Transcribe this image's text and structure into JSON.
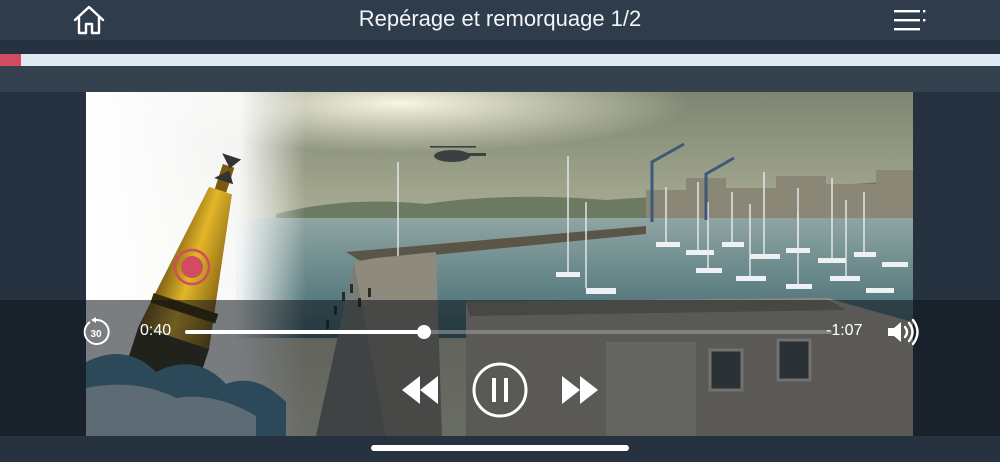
{
  "header": {
    "title": "Repérage et remorquage 1/2",
    "home_icon": "home-icon",
    "menu_icon": "menu-list-icon"
  },
  "lesson_progress": {
    "value": 0.021,
    "color": "#d04c5e",
    "track_color": "#dfe9f2"
  },
  "player": {
    "elapsed": "0:40",
    "remaining": "-1:07",
    "position_fraction": 0.37,
    "replay_icon": "replay-30-icon",
    "replay_label": "30",
    "rewind_icon": "rewind-icon",
    "play_pause_icon": "pause-icon",
    "forward_icon": "fast-forward-icon",
    "volume_icon": "volume-icon"
  },
  "colors": {
    "accent": "#d04c5e",
    "background": "#263240",
    "header": "#2f3c4c"
  }
}
